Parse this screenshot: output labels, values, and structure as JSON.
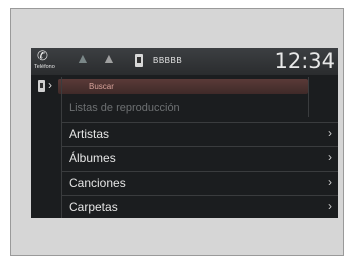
{
  "status_bar": {
    "phone_label": "Teléfono",
    "device_name": "BBBBB",
    "clock": "12:34"
  },
  "breadcrumb": {
    "search_label": "Buscar"
  },
  "menu": {
    "items": [
      {
        "label": "Listas de reproducción",
        "enabled": false
      },
      {
        "label": "Artistas",
        "enabled": true
      },
      {
        "label": "Álbumes",
        "enabled": true
      },
      {
        "label": "Canciones",
        "enabled": true
      },
      {
        "label": "Carpetas",
        "enabled": true
      }
    ]
  },
  "icons": {
    "phone": "phone-icon",
    "person1": "person-icon",
    "person2": "person-icon",
    "device": "phone-device-icon",
    "chevron": "chevron-right-icon"
  },
  "colors": {
    "screen_bg": "#1b1d1f",
    "search_pill": "#4a3230",
    "search_text": "#d9a29a"
  }
}
